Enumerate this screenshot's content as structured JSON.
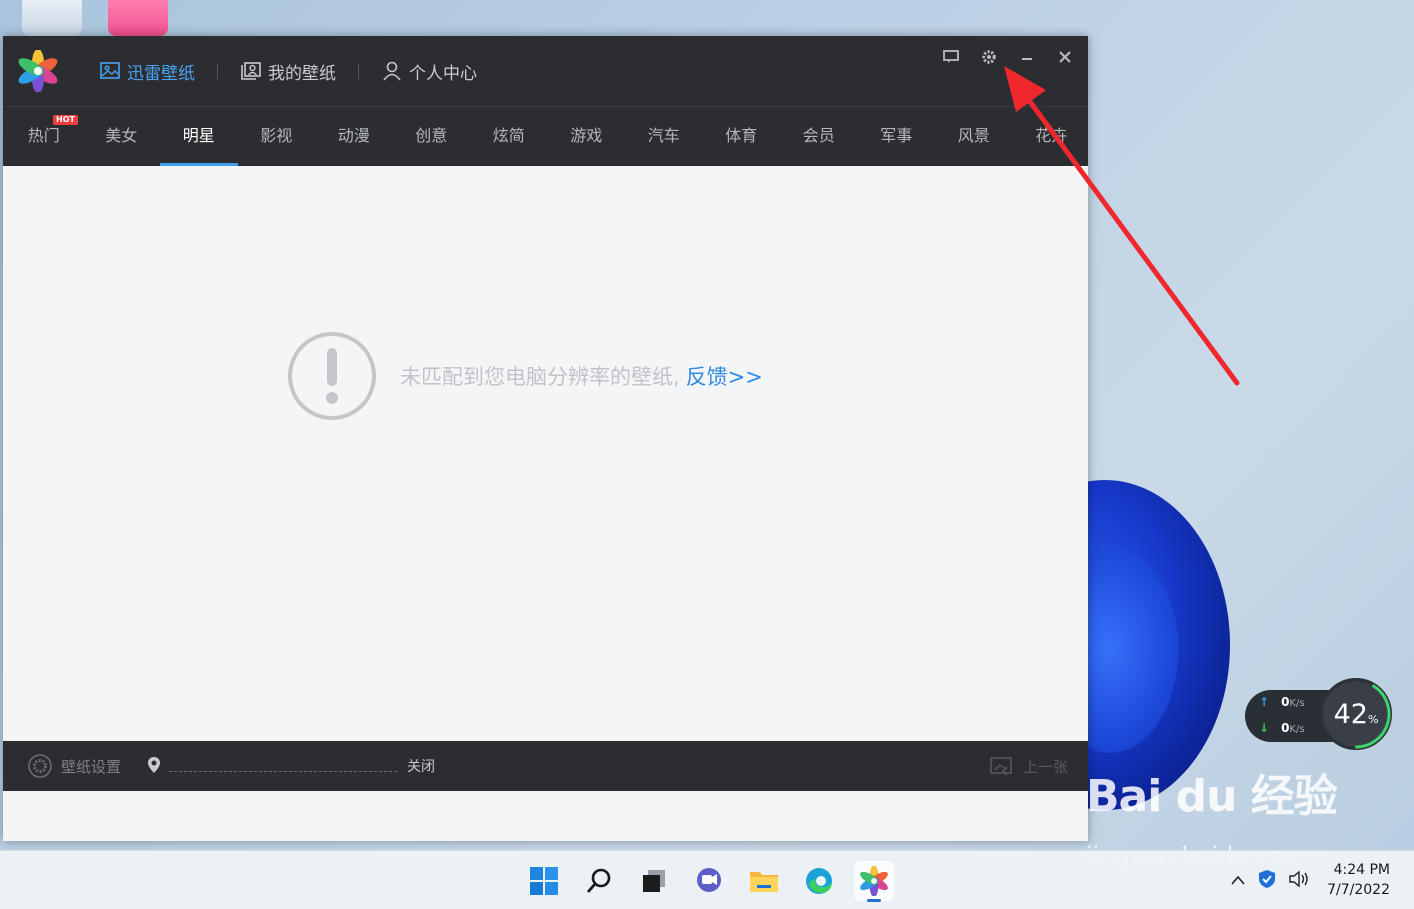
{
  "app": {
    "top_nav": [
      {
        "label": "迅雷壁纸",
        "icon": "picture-icon",
        "active": true
      },
      {
        "label": "我的壁纸",
        "icon": "portrait-icon",
        "active": false
      },
      {
        "label": "个人中心",
        "icon": "user-icon",
        "active": false
      }
    ],
    "window_controls": [
      "chat-icon",
      "gear-icon",
      "minimize-icon",
      "close-icon"
    ],
    "categories": [
      {
        "label": "热门",
        "badge": "HOT"
      },
      {
        "label": "美女"
      },
      {
        "label": "明星",
        "active": true
      },
      {
        "label": "影视"
      },
      {
        "label": "动漫"
      },
      {
        "label": "创意"
      },
      {
        "label": "炫简"
      },
      {
        "label": "游戏"
      },
      {
        "label": "汽车"
      },
      {
        "label": "体育"
      },
      {
        "label": "会员"
      },
      {
        "label": "军事"
      },
      {
        "label": "风景"
      },
      {
        "label": "花卉"
      }
    ],
    "notice": {
      "message": "未匹配到您电脑分辨率的壁纸,",
      "link": "反馈>>"
    },
    "bottom": {
      "settings_label": "壁纸设置",
      "toggle_label": "关闭",
      "prev_label": "上一张"
    },
    "colors": {
      "accent": "#3d9bf0",
      "titlebar": "#2b2d31",
      "link": "#2f8ae6"
    }
  },
  "netspeed": {
    "up_value": "0",
    "up_unit": "K/s",
    "down_value": "0",
    "down_unit": "K/s",
    "gauge_value": "42",
    "gauge_unit": "%"
  },
  "watermark": {
    "brand": "Bai du 经验",
    "site": "jingyan.baidu.com"
  },
  "taskbar": {
    "apps": [
      "windows-start-icon",
      "search-icon",
      "task-view-icon",
      "chat-icon",
      "file-explorer-icon",
      "edge-icon",
      "wallpaper-app-icon"
    ],
    "time": "4:24 PM",
    "date": "7/7/2022"
  }
}
